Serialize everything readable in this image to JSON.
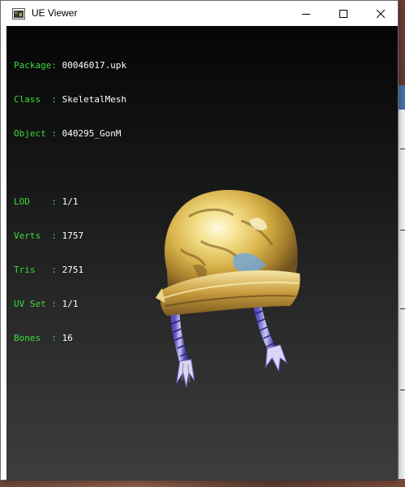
{
  "window": {
    "title": "UE Viewer",
    "icon": "ue-viewer-app-icon",
    "controls": {
      "minimize_icon": "minimize-icon",
      "maximize_icon": "maximize-icon",
      "close_icon": "close-icon"
    }
  },
  "info": {
    "package_key": "Package:",
    "package_value": "00046017.upk",
    "class_key": "Class  :",
    "class_value": "SkeletalMesh",
    "object_key": "Object :",
    "object_value": "040295_GonM",
    "lod_key": "LOD    :",
    "lod_value": "1/1",
    "verts_key": "Verts  :",
    "verts_value": "1757",
    "tris_key": "Tris   :",
    "tris_value": "2751",
    "uvset_key": "UV Set :",
    "uvset_value": "1/1",
    "bones_key": "Bones  :",
    "bones_value": "16"
  },
  "colors": {
    "label_green": "#3ddc3d",
    "value_white": "#ffffff",
    "viewport_top": "#050505",
    "viewport_bottom": "#3d3d3d",
    "close_hover": "#e81123"
  }
}
